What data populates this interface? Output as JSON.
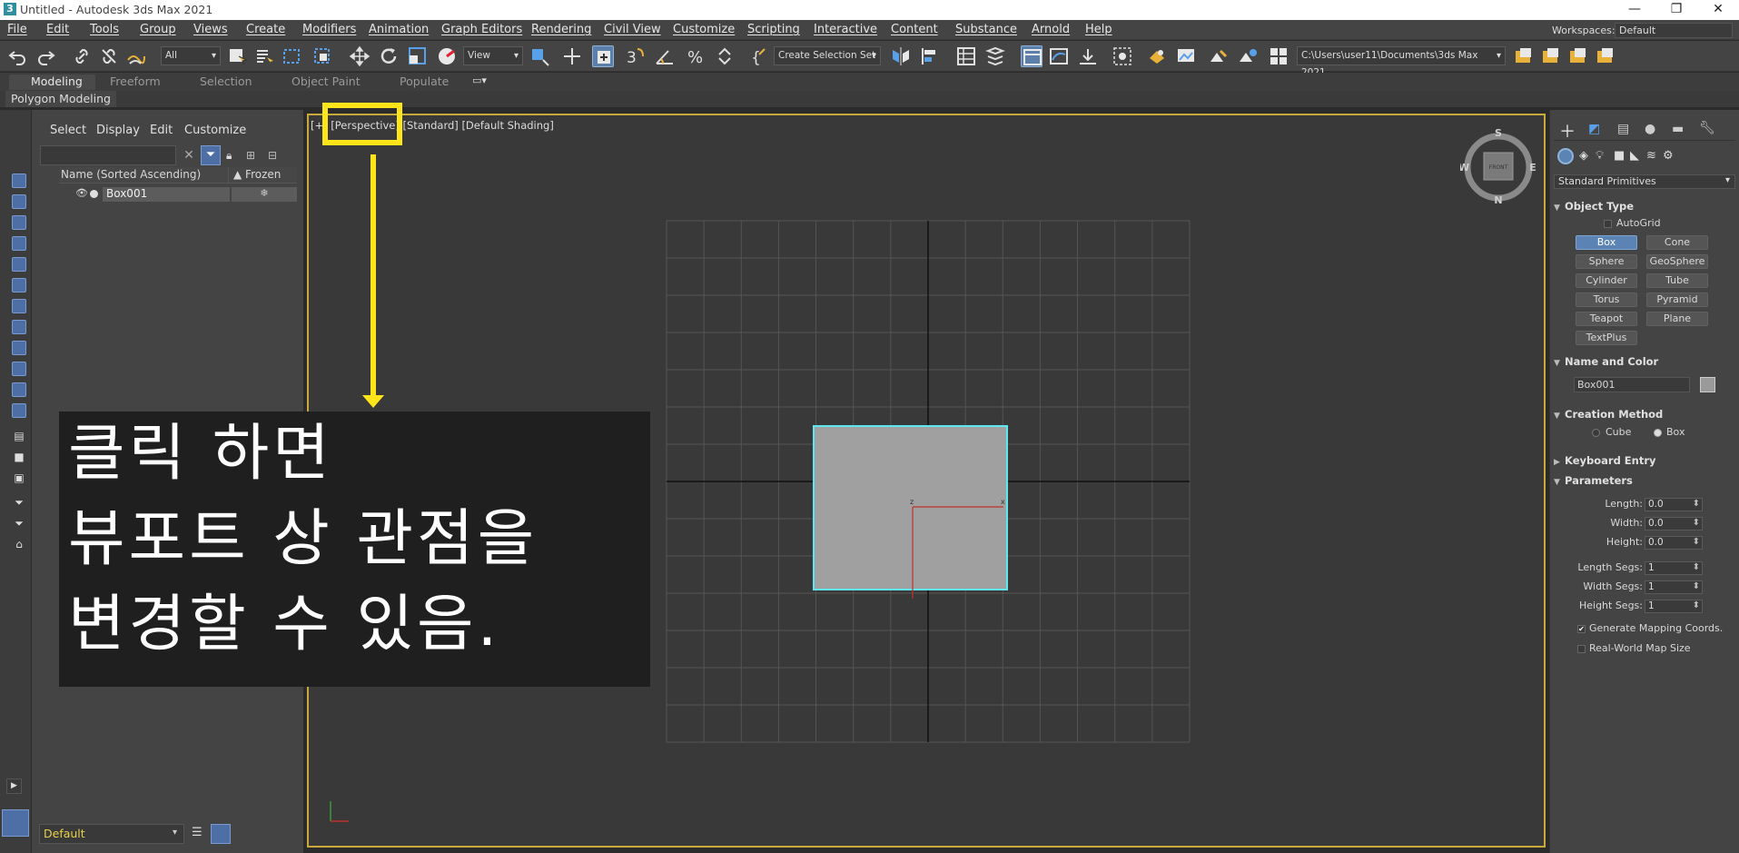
{
  "titlebar": {
    "icon": "3",
    "title": "Untitled - Autodesk 3ds Max 2021",
    "minimize": "—",
    "restore": "❐",
    "close": "✕"
  },
  "menu": [
    "File",
    "Edit",
    "Tools",
    "Group",
    "Views",
    "Create",
    "Modifiers",
    "Animation",
    "Graph Editors",
    "Rendering",
    "Civil View",
    "Customize",
    "Scripting",
    "Interactive",
    "Content",
    "Substance",
    "Arnold",
    "Help"
  ],
  "workspaces": {
    "label": "Workspaces:",
    "value": "Default"
  },
  "toolbar": {
    "selection_filter": "All",
    "ref_coord": "View",
    "named_selection": "Create Selection Set",
    "project_path": "C:\\Users\\user11\\Documents\\3ds Max 2021"
  },
  "ribbon": {
    "tabs": [
      "Modeling",
      "Freeform",
      "Selection",
      "Object Paint",
      "Populate"
    ],
    "active_tab": "Modeling",
    "panel": "Polygon Modeling"
  },
  "scene_explorer": {
    "tabs": [
      "Select",
      "Display",
      "Edit",
      "Customize"
    ],
    "col_name": "Name (Sorted Ascending)",
    "col_frozen": "▲ Frozen",
    "rows": [
      {
        "name": "Box001"
      }
    ],
    "layer": "Default"
  },
  "viewport": {
    "label_prefix": "[+]",
    "label_view": "[Perspective]",
    "label_rest": "[Standard] [Default Shading]",
    "viewcube_face": "FRONT",
    "compass": {
      "n": "N",
      "s": "S",
      "e": "E",
      "w": "W"
    },
    "gizmo": {
      "x": "x",
      "z": "z"
    }
  },
  "annotation": {
    "lines": [
      "클릭 하면",
      "뷰포트 상 관점을",
      "변경할 수 있음."
    ],
    "color": "#ffe51a"
  },
  "command_panel": {
    "category": "Standard Primitives",
    "object_type": {
      "title": "Object Type",
      "autogrid": "AutoGrid",
      "buttons": [
        "Box",
        "Cone",
        "Sphere",
        "GeoSphere",
        "Cylinder",
        "Tube",
        "Torus",
        "Pyramid",
        "Teapot",
        "Plane",
        "TextPlus"
      ],
      "selected": "Box"
    },
    "name_color": {
      "title": "Name and Color",
      "name": "Box001",
      "swatch": "#9a9a9a"
    },
    "creation_method": {
      "title": "Creation Method",
      "options": [
        "Cube",
        "Box"
      ],
      "selected": "Box"
    },
    "keyboard_entry": {
      "title": "Keyboard Entry"
    },
    "parameters": {
      "title": "Parameters",
      "fields": [
        {
          "label": "Length:",
          "value": "0.0"
        },
        {
          "label": "Width:",
          "value": "0.0"
        },
        {
          "label": "Height:",
          "value": "0.0"
        }
      ],
      "segs": [
        {
          "label": "Length Segs:",
          "value": "1"
        },
        {
          "label": "Width Segs:",
          "value": "1"
        },
        {
          "label": "Height Segs:",
          "value": "1"
        }
      ],
      "gen_mapping": "Generate Mapping Coords.",
      "gen_mapping_checked": true,
      "real_world": "Real-World Map Size",
      "real_world_checked": false
    }
  }
}
